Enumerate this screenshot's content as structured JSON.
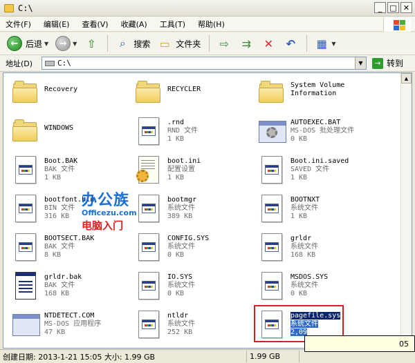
{
  "window": {
    "title": "C:\\",
    "controls": {
      "minimize": "_",
      "maximize": "□",
      "close": "✕"
    }
  },
  "menu": [
    "文件(F)",
    "编辑(E)",
    "查看(V)",
    "收藏(A)",
    "工具(T)",
    "帮助(H)"
  ],
  "toolbar": {
    "back_label": "后退",
    "search_label": "搜索",
    "folders_label": "文件夹"
  },
  "address": {
    "label": "地址(D)",
    "value": "C:\\",
    "go_label": "转到"
  },
  "files": [
    {
      "name": "Recovery",
      "icon": "folder-icon"
    },
    {
      "name": "RECYCLER",
      "icon": "folder-icon"
    },
    {
      "name": "System Volume",
      "name2": "Information",
      "icon": "folder-icon"
    },
    {
      "name": "WINDOWS",
      "icon": "folder-icon"
    },
    {
      "name": ".rnd",
      "type": "RND 文件",
      "size": "1 KB",
      "icon": "file-icon"
    },
    {
      "name": "AUTOEXEC.BAT",
      "type": "MS-DOS 批处理文件",
      "size": "0 KB",
      "icon": "batch-file-icon"
    },
    {
      "name": "Boot.BAK",
      "type": "BAK 文件",
      "size": "1 KB",
      "icon": "file-icon"
    },
    {
      "name": "boot.ini",
      "type": "配置设置",
      "size": "1 KB",
      "icon": "config-file-icon"
    },
    {
      "name": "Boot.ini.saved",
      "type": "SAVED 文件",
      "size": "1 KB",
      "icon": "file-icon"
    },
    {
      "name": "bootfont.bin",
      "type": "BIN 文件",
      "size": "316 KB",
      "icon": "file-icon"
    },
    {
      "name": "bootmgr",
      "type": "系统文件",
      "size": "389 KB",
      "icon": "file-icon"
    },
    {
      "name": "BOOTNXT",
      "type": "系统文件",
      "size": "1 KB",
      "icon": "file-icon"
    },
    {
      "name": "BOOTSECT.BAK",
      "type": "BAK 文件",
      "size": "8 KB",
      "icon": "file-icon"
    },
    {
      "name": "CONFIG.SYS",
      "type": "系统文件",
      "size": "0 KB",
      "icon": "file-icon"
    },
    {
      "name": "grldr",
      "type": "系统文件",
      "size": "168 KB",
      "icon": "file-icon"
    },
    {
      "name": "grldr.bak",
      "type": "BAK 文件",
      "size": "168 KB",
      "icon": "backup-file-icon"
    },
    {
      "name": "IO.SYS",
      "type": "系统文件",
      "size": "0 KB",
      "icon": "file-icon"
    },
    {
      "name": "MSDOS.SYS",
      "type": "系统文件",
      "size": "0 KB",
      "icon": "file-icon"
    },
    {
      "name": "NTDETECT.COM",
      "type": "MS-DOS 应用程序",
      "size": "47 KB",
      "icon": "application-icon"
    },
    {
      "name": "ntldr",
      "type": "系统文件",
      "size": "252 KB",
      "icon": "file-icon"
    },
    {
      "name": "pagefile.sys",
      "type": "系统文件",
      "size": "2,09",
      "icon": "file-icon",
      "selected": true
    }
  ],
  "watermark": {
    "brand": "办公族",
    "url": "Officezu.com",
    "tagline": "电脑入门"
  },
  "status": {
    "created": "创建日期: 2013-1-21 15:05 大小: 1.99 GB",
    "size": "1.99 GB",
    "tooltip_fragment": "05"
  }
}
